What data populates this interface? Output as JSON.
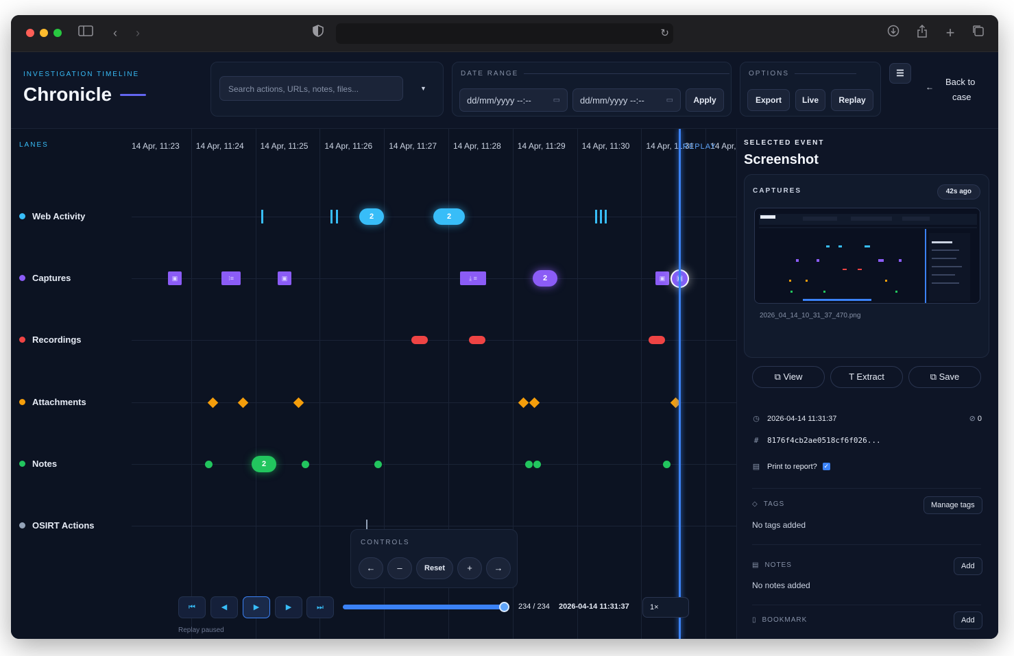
{
  "header": {
    "eyebrow": "INVESTIGATION TIMELINE",
    "brand": "Chronicle",
    "search_placeholder": "Search actions, URLs, notes, files...",
    "date_range_label": "DATE RANGE",
    "date_from_placeholder": "dd/mm/yyyy --:--",
    "date_to_placeholder": "dd/mm/yyyy --:--",
    "apply": "Apply",
    "options_label": "OPTIONS",
    "export": "Export",
    "live": "Live",
    "replay": "Replay",
    "menu_icon": "☰",
    "back_line1": "Back to",
    "back_line2": "case"
  },
  "lanes_label": "LANES",
  "lanes": [
    {
      "name": "Web Activity",
      "color": "#38bdf8"
    },
    {
      "name": "Captures",
      "color": "#8b5cf6"
    },
    {
      "name": "Recordings",
      "color": "#ef4444"
    },
    {
      "name": "Attachments",
      "color": "#f59e0b"
    },
    {
      "name": "Notes",
      "color": "#22c55e"
    },
    {
      "name": "OSIRT Actions",
      "color": "#94a3b8"
    }
  ],
  "ticks": [
    "14 Apr, 11:23",
    "14 Apr, 11:24",
    "14 Apr, 11:25",
    "14 Apr, 11:26",
    "14 Apr, 11:27",
    "14 Apr, 11:28",
    "14 Apr, 11:29",
    "14 Apr, 11:30",
    "14 Apr, 11:31",
    "14 Apr,"
  ],
  "replay_tag": "REPLAY",
  "cluster_counts": {
    "web_a": "2",
    "web_b": "2",
    "captures": "2",
    "notes": "2"
  },
  "controls": {
    "label": "CONTROLS",
    "left": "←",
    "minus": "–",
    "reset": "Reset",
    "plus": "+",
    "right": "→"
  },
  "transport": {
    "first": "⏮",
    "prev": "◀",
    "play": "▶",
    "next": "▶",
    "last": "⏭",
    "counter": "234 / 234",
    "timestamp": "2026-04-14 11:31:37",
    "speed": "1×",
    "status": "Replay paused",
    "progress": 1.0
  },
  "panel": {
    "eyebrow": "SELECTED EVENT",
    "title": "Screenshot",
    "captures_label": "CAPTURES",
    "age": "42s ago",
    "filename": "2026_04_14_10_31_37_470.png",
    "view": "View",
    "extract": "Extract",
    "save": "Save",
    "time": "2026-04-14 11:31:37",
    "links": "0",
    "hash": "8176f4cb2ae0518cf6f026...",
    "print_label": "Print to report?",
    "print_checked": true,
    "tags_label": "TAGS",
    "manage_tags": "Manage tags",
    "no_tags": "No tags added",
    "notes_label": "NOTES",
    "notes_add": "Add",
    "no_notes": "No notes added",
    "bookmark_label": "BOOKMARK",
    "bookmark_add": "Add"
  }
}
